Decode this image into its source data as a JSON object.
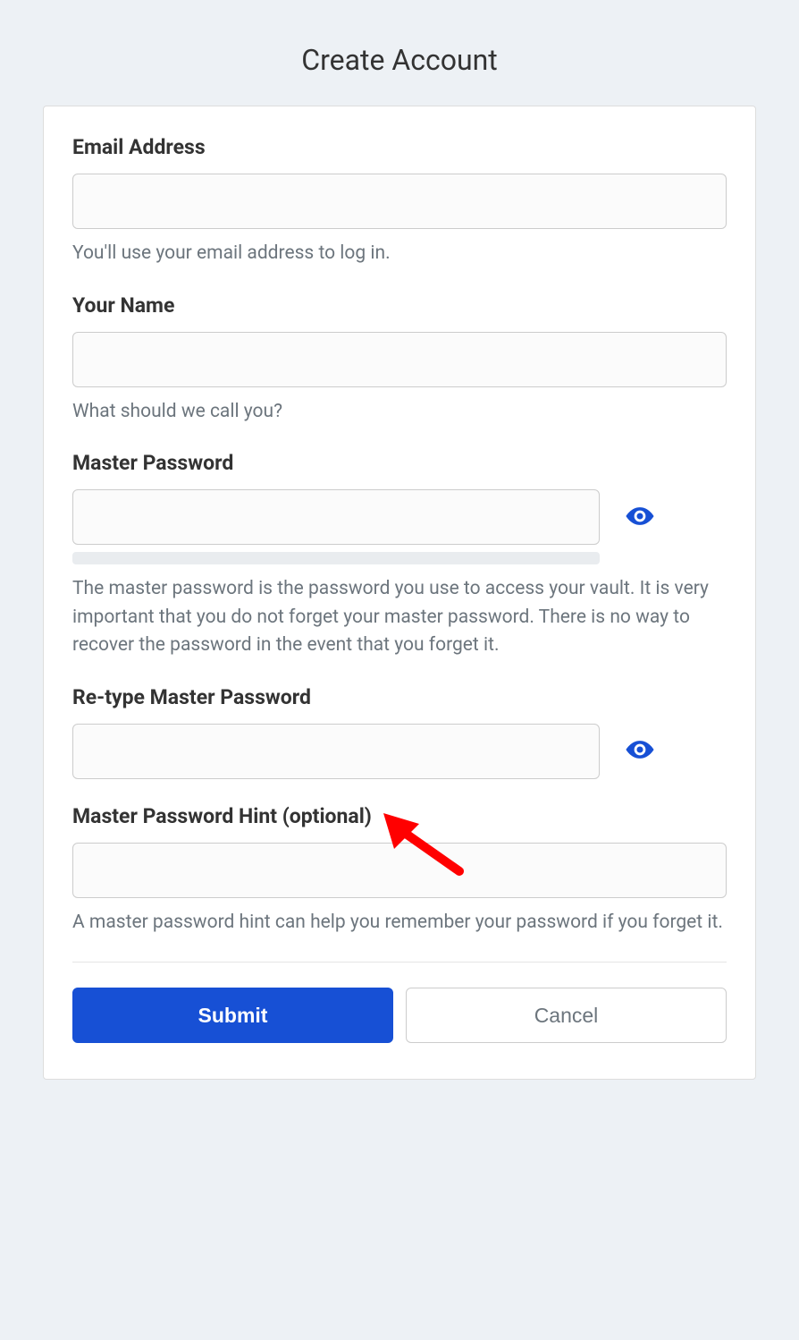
{
  "page_title": "Create Account",
  "fields": {
    "email": {
      "label": "Email Address",
      "help": "You'll use your email address to log in."
    },
    "name": {
      "label": "Your Name",
      "help": "What should we call you?"
    },
    "master_password": {
      "label": "Master Password",
      "help": "The master password is the password you use to access your vault. It is very important that you do not forget your master password. There is no way to recover the password in the event that you forget it."
    },
    "retype_password": {
      "label": "Re-type Master Password"
    },
    "hint": {
      "label": "Master Password Hint (optional)",
      "help": "A master password hint can help you remember your password if you forget it."
    }
  },
  "buttons": {
    "submit": "Submit",
    "cancel": "Cancel"
  }
}
